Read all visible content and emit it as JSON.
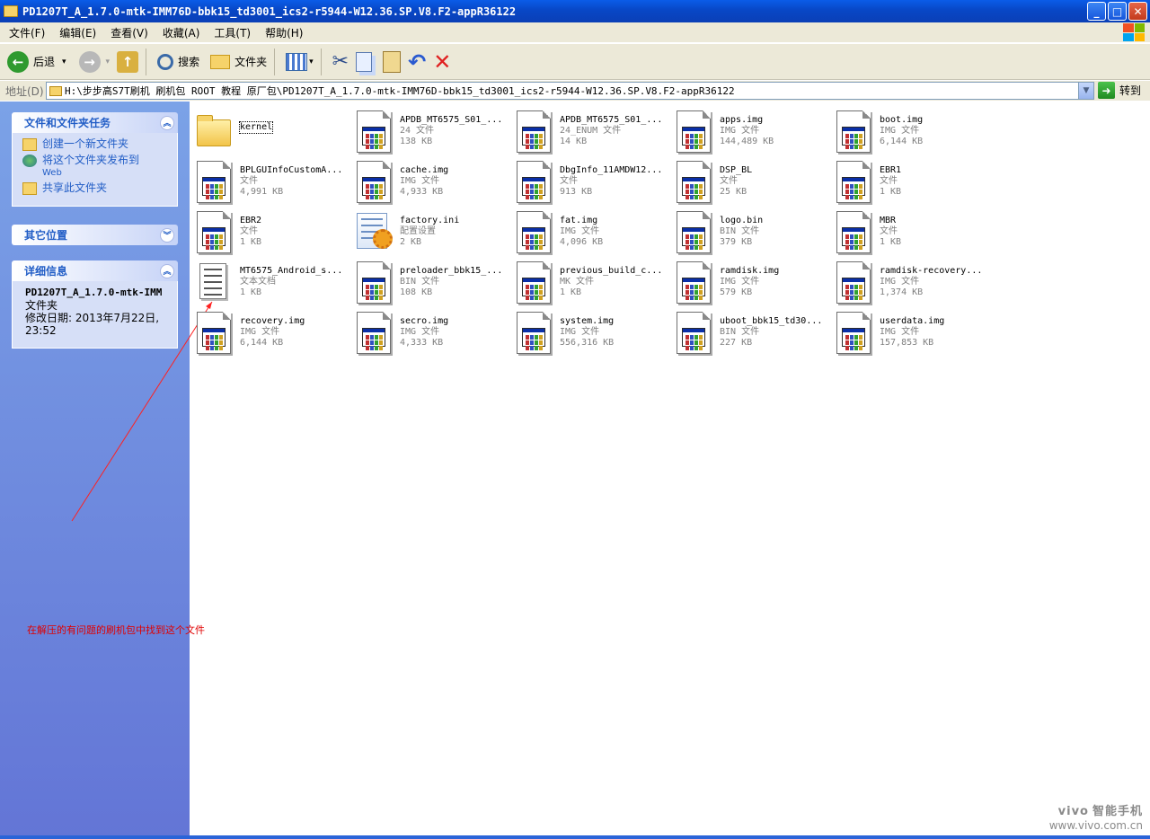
{
  "window": {
    "title": "PD1207T_A_1.7.0-mtk-IMM76D-bbk15_td3001_ics2-r5944-W12.36.SP.V8.F2-appR36122",
    "minimize": "_",
    "maximize": "□",
    "close": "✕"
  },
  "menu": [
    "文件(F)",
    "编辑(E)",
    "查看(V)",
    "收藏(A)",
    "工具(T)",
    "帮助(H)"
  ],
  "toolbar": {
    "back_label": "后退",
    "search_label": "搜索",
    "folders_label": "文件夹",
    "forward_arrow": "→",
    "back_arrow": "←",
    "up_arrow": "↑",
    "dropdown": "▾",
    "cut_glyph": "✂",
    "undo_glyph": "↶",
    "delete_glyph": "✕"
  },
  "address": {
    "label": "地址(D)",
    "path": "H:\\步步高S7T刷机 刷机包 ROOT 教程 原厂包\\PD1207T_A_1.7.0-mtk-IMM76D-bbk15_td3001_ics2-r5944-W12.36.SP.V8.F2-appR36122",
    "go_label": "转到",
    "go_glyph": "➜",
    "dd_glyph": "▼"
  },
  "sidebar": {
    "tasks": {
      "title": "文件和文件夹任务",
      "chev": "︽",
      "items": [
        "创建一个新文件夹",
        "将这个文件夹发布到",
        "Web",
        "共享此文件夹"
      ]
    },
    "other": {
      "title": "其它位置",
      "chev": "︾"
    },
    "details": {
      "title": "详细信息",
      "chev": "︽",
      "name": "PD1207T_A_1.7.0-mtk-IMM",
      "type": "文件夹",
      "modified": "修改日期: 2013年7月22日,",
      "time": "23:52"
    }
  },
  "files": [
    {
      "name": "kernel",
      "type": "",
      "size": "",
      "icon": "folder-icon"
    },
    {
      "name": "APDB_MT6575_S01_...",
      "type": "24 文件",
      "size": "138 KB",
      "icon": "system-file-icon"
    },
    {
      "name": "APDB_MT6575_S01_...",
      "type": "24_ENUM 文件",
      "size": "14 KB",
      "icon": "system-file-icon"
    },
    {
      "name": "apps.img",
      "type": "IMG 文件",
      "size": "144,489 KB",
      "icon": "system-file-icon"
    },
    {
      "name": "boot.img",
      "type": "IMG 文件",
      "size": "6,144 KB",
      "icon": "system-file-icon"
    },
    {
      "name": "BPLGUInfoCustomA...",
      "type": "文件",
      "size": "4,991 KB",
      "icon": "system-file-icon"
    },
    {
      "name": "cache.img",
      "type": "IMG 文件",
      "size": "4,933 KB",
      "icon": "system-file-icon"
    },
    {
      "name": "DbgInfo_11AMDW12...",
      "type": "文件",
      "size": "913 KB",
      "icon": "system-file-icon"
    },
    {
      "name": "DSP_BL",
      "type": "文件",
      "size": "25 KB",
      "icon": "system-file-icon"
    },
    {
      "name": "EBR1",
      "type": "文件",
      "size": "1 KB",
      "icon": "system-file-icon"
    },
    {
      "name": "EBR2",
      "type": "文件",
      "size": "1 KB",
      "icon": "system-file-icon"
    },
    {
      "name": "factory.ini",
      "type": "配置设置",
      "size": "2 KB",
      "icon": "settings-file-icon"
    },
    {
      "name": "fat.img",
      "type": "IMG 文件",
      "size": "4,096 KB",
      "icon": "system-file-icon"
    },
    {
      "name": "logo.bin",
      "type": "BIN 文件",
      "size": "379 KB",
      "icon": "system-file-icon"
    },
    {
      "name": "MBR",
      "type": "文件",
      "size": "1 KB",
      "icon": "system-file-icon"
    },
    {
      "name": "MT6575_Android_s...",
      "type": "文本文档",
      "size": "1 KB",
      "icon": "text-document-icon"
    },
    {
      "name": "preloader_bbk15_...",
      "type": "BIN 文件",
      "size": "108 KB",
      "icon": "system-file-icon"
    },
    {
      "name": "previous_build_c...",
      "type": "MK 文件",
      "size": "1 KB",
      "icon": "system-file-icon"
    },
    {
      "name": "ramdisk.img",
      "type": "IMG 文件",
      "size": "579 KB",
      "icon": "system-file-icon"
    },
    {
      "name": "ramdisk-recovery...",
      "type": "IMG 文件",
      "size": "1,374 KB",
      "icon": "system-file-icon"
    },
    {
      "name": "recovery.img",
      "type": "IMG 文件",
      "size": "6,144 KB",
      "icon": "system-file-icon"
    },
    {
      "name": "secro.img",
      "type": "IMG 文件",
      "size": "4,333 KB",
      "icon": "system-file-icon"
    },
    {
      "name": "system.img",
      "type": "IMG 文件",
      "size": "556,316 KB",
      "icon": "system-file-icon"
    },
    {
      "name": "uboot_bbk15_td30...",
      "type": "BIN 文件",
      "size": "227 KB",
      "icon": "system-file-icon"
    },
    {
      "name": "userdata.img",
      "type": "IMG 文件",
      "size": "157,853 KB",
      "icon": "system-file-icon"
    }
  ],
  "annotation": "在解压的有问题的刷机包中找到这个文件",
  "watermark": {
    "brand": "vivo",
    "tagline": "智能手机",
    "url": "www.vivo.com.cn"
  },
  "colors": {
    "title_bar": "#0a4fd4",
    "sidebar": "#7ba2e7",
    "task_link": "#215dc6",
    "annotation": "#e00000"
  }
}
